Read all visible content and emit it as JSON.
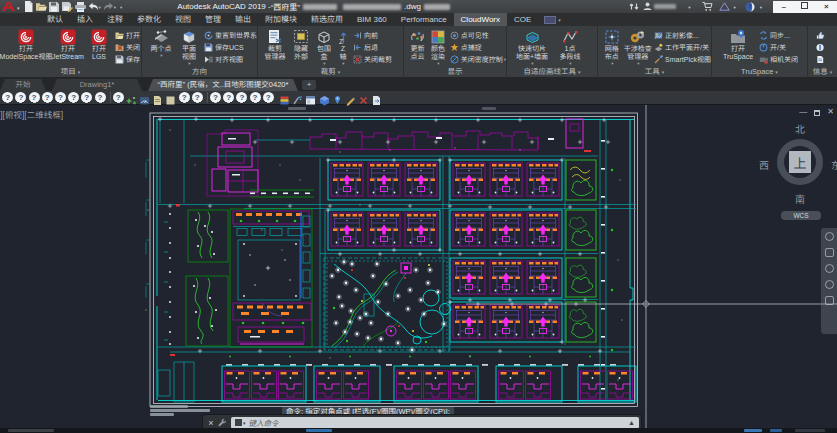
{
  "window": {
    "title_prefix": "Autodesk AutoCAD 2019 - ",
    "title_doc": "“西府里”",
    "title_ext": ".dwg",
    "minimize_glyph": "–",
    "close_glyph": "×"
  },
  "ribbon": {
    "tabs": [
      "默认",
      "插入",
      "注释",
      "参数化",
      "视图",
      "管理",
      "输出",
      "附加模块",
      "精选应用",
      "BIM 360",
      "Performance",
      "CloudWorx",
      "COE"
    ],
    "active_tab": "CloudWorx",
    "panels": [
      {
        "label": "项目",
        "big": [
          [
            "打开",
            "ModelSpace视图"
          ],
          [
            "打开",
            "JetStream"
          ],
          [
            "打开",
            "LGS"
          ]
        ],
        "small": [
          "打开",
          "关闭",
          "保存"
        ]
      },
      {
        "label": "方向",
        "big": [
          [
            "两个点",
            ""
          ],
          [
            "平面",
            "视图"
          ]
        ],
        "small": [
          "重置到世界系",
          "保存UCS",
          "对齐视图"
        ]
      },
      {
        "label": "裁剪",
        "big": [
          [
            "裁剪",
            "管理器"
          ],
          [
            "隐藏",
            "外部"
          ],
          [
            "包围",
            "盒"
          ],
          [
            "Z",
            "轴"
          ]
        ],
        "small": [
          "向前",
          "后退",
          "关闭裁剪"
        ]
      },
      {
        "label": "显示",
        "big": [
          [
            "更新",
            "点云"
          ],
          [
            "颜色",
            "渲染"
          ]
        ],
        "small": [
          "点可见性",
          "点捕捉",
          "关闭密度控制"
        ]
      },
      {
        "label": "自适应画线工具",
        "big": [
          [
            "快速切片",
            "地面+墙面"
          ],
          [
            "1点",
            "多段线"
          ]
        ],
        "small": []
      },
      {
        "label": "工具",
        "big": [
          [
            "网格",
            "布点"
          ],
          [
            "干涉检查",
            "管理器"
          ]
        ],
        "small": [
          "正射影像...",
          "工作平面开/关",
          "SmartPick视图"
        ]
      },
      {
        "label": "TruSpace",
        "big": [
          [
            "打开",
            "TruSpace"
          ]
        ],
        "small": [
          "同步...",
          "开/关",
          "相机关闭"
        ]
      },
      {
        "label": "信息",
        "big": [],
        "small": []
      }
    ]
  },
  "file_tabs": {
    "tabs": [
      "开始",
      "Drawing1*",
      "“西府里” (民宿，文..目地形图提交0420*"
    ],
    "active_index": 2,
    "new_tab": "+"
  },
  "custom_toolbar": {
    "unknown_glyph": "?"
  },
  "viewport": {
    "label": "[-][俯视][二维线框]",
    "compass": {
      "n": "北",
      "s": "南",
      "w": "西",
      "e": "东",
      "center": "上"
    },
    "ucs": "WCS"
  },
  "command": {
    "overlay": "命令: 指定对角点或 [栏选(F)/圈围(WP)/圈交(CP)]:",
    "placeholder": "键入命令"
  }
}
